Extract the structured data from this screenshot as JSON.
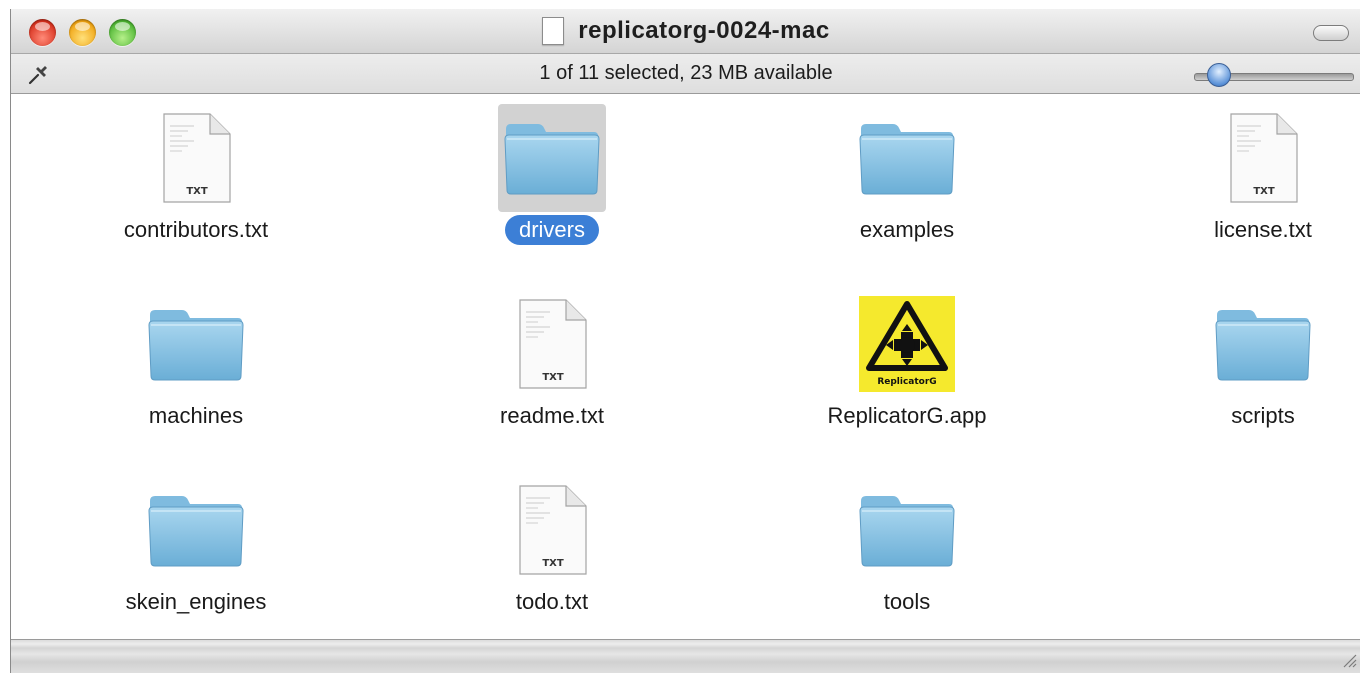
{
  "window": {
    "title": "replicatorg-0024-mac",
    "status": "1 of 11 selected, 23 MB available",
    "icon_size_slider_fraction": 0.15
  },
  "icons": {
    "pin": "pin-icon",
    "folder": "folder-icon",
    "txt_file": "txt-file-icon",
    "app": "replicatorg-app-icon"
  },
  "app_icon_caption": "ReplicatorG",
  "file_badge": "TXT",
  "items": [
    {
      "name": "contributors.txt",
      "kind": "txt",
      "selected": false
    },
    {
      "name": "drivers",
      "kind": "folder",
      "selected": true
    },
    {
      "name": "examples",
      "kind": "folder",
      "selected": false
    },
    {
      "name": "license.txt",
      "kind": "txt",
      "selected": false
    },
    {
      "name": "machines",
      "kind": "folder",
      "selected": false
    },
    {
      "name": "readme.txt",
      "kind": "txt",
      "selected": false
    },
    {
      "name": "ReplicatorG.app",
      "kind": "app",
      "selected": false
    },
    {
      "name": "scripts",
      "kind": "folder",
      "selected": false
    },
    {
      "name": "skein_engines",
      "kind": "folder",
      "selected": false
    },
    {
      "name": "todo.txt",
      "kind": "txt",
      "selected": false
    },
    {
      "name": "tools",
      "kind": "folder",
      "selected": false
    }
  ],
  "colors": {
    "selection": "#3c7fd6",
    "folder": "#8ec4e4",
    "app_background": "#f5e92d"
  }
}
